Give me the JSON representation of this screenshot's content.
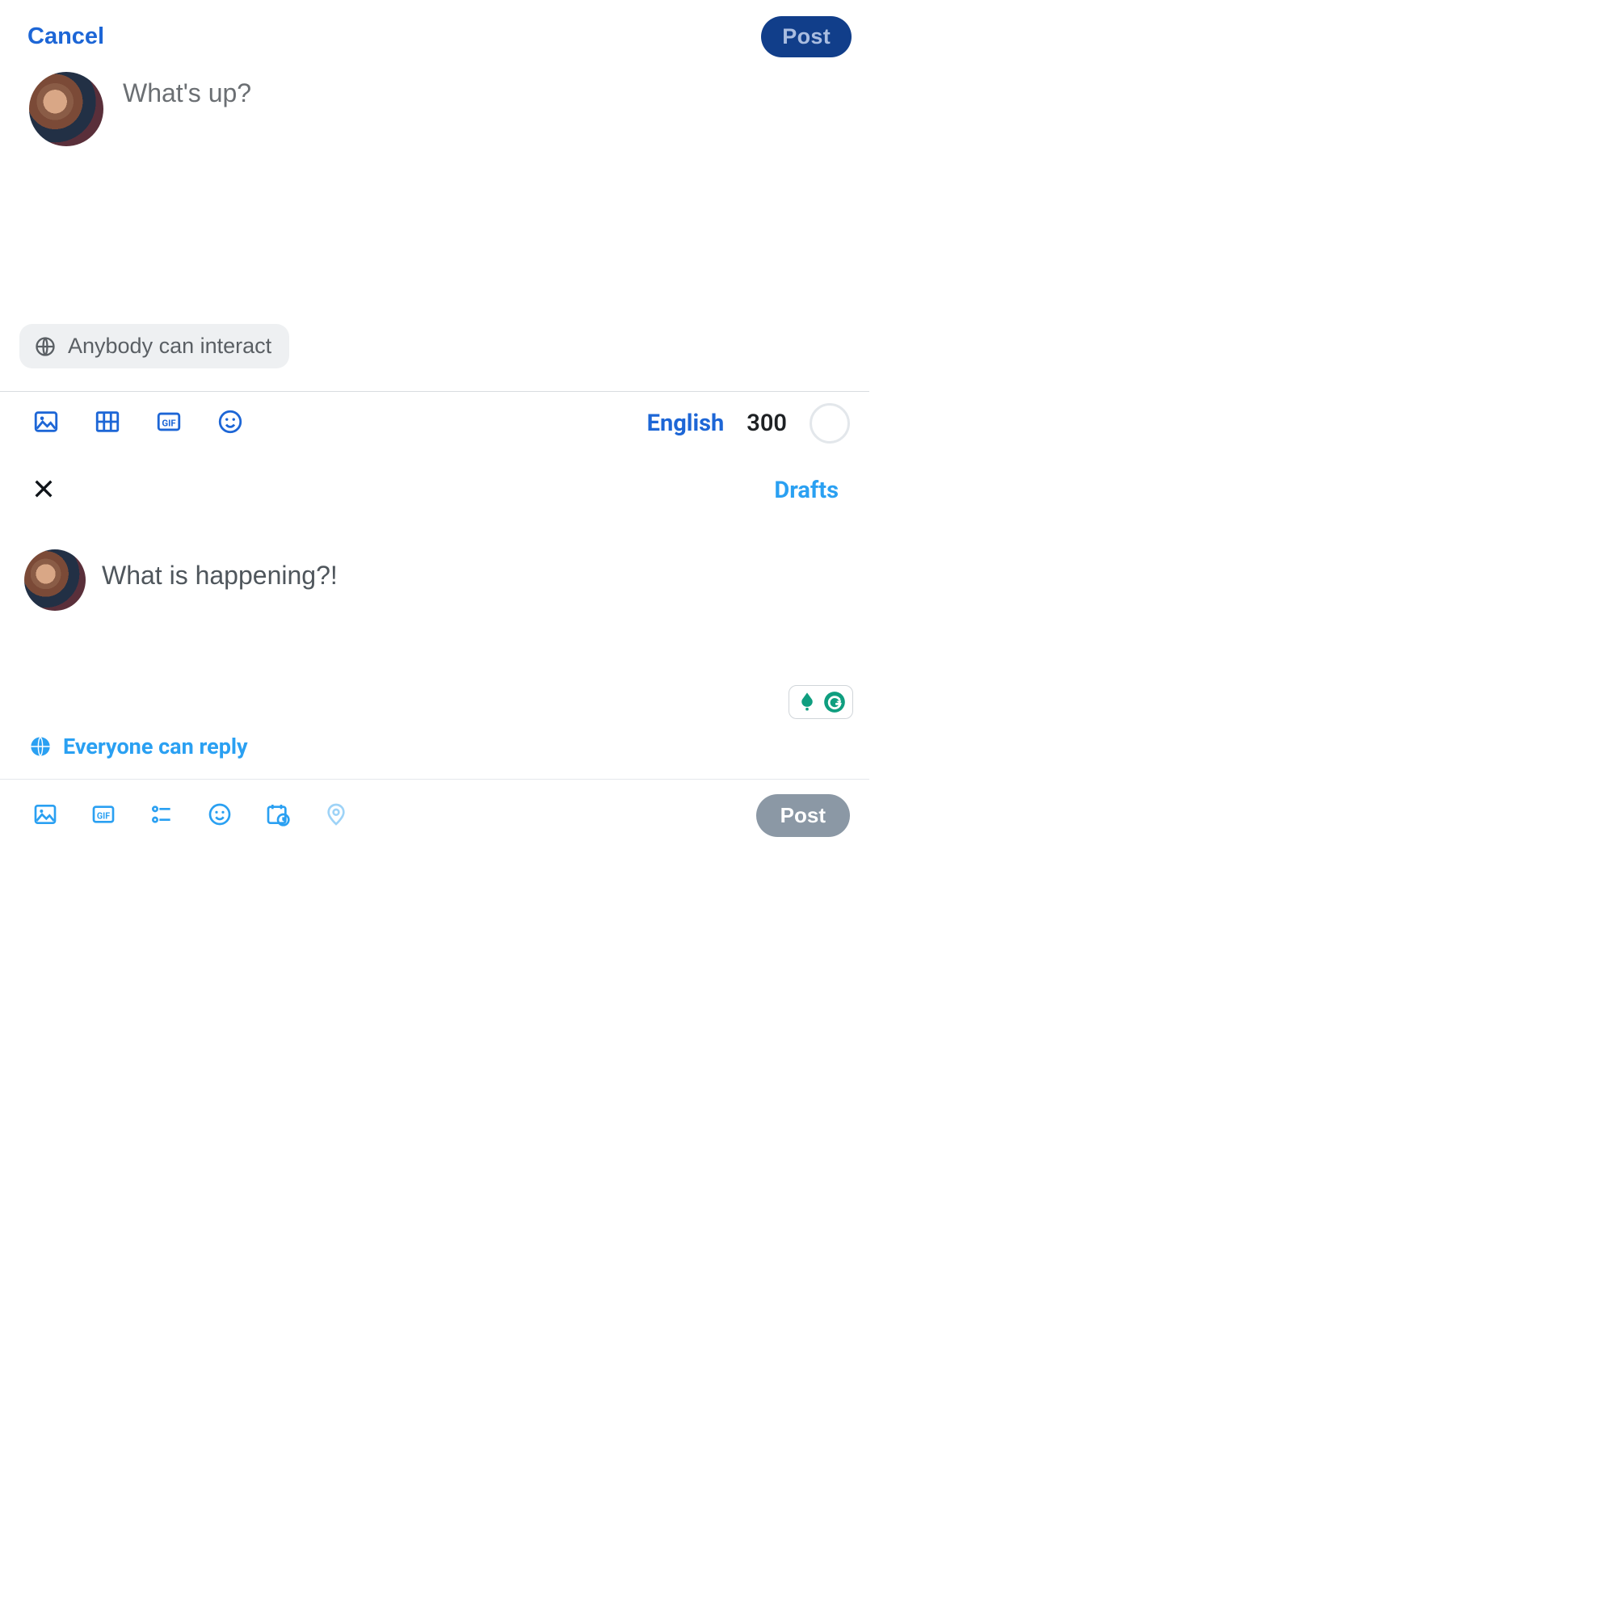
{
  "top": {
    "cancel_label": "Cancel",
    "post_label": "Post",
    "placeholder": "What's up?",
    "interact_label": "Anybody can interact",
    "language_label": "English",
    "char_remaining": "300"
  },
  "bottom": {
    "drafts_label": "Drafts",
    "placeholder": "What is happening?!",
    "reply_label": "Everyone can reply",
    "post_label": "Post"
  }
}
